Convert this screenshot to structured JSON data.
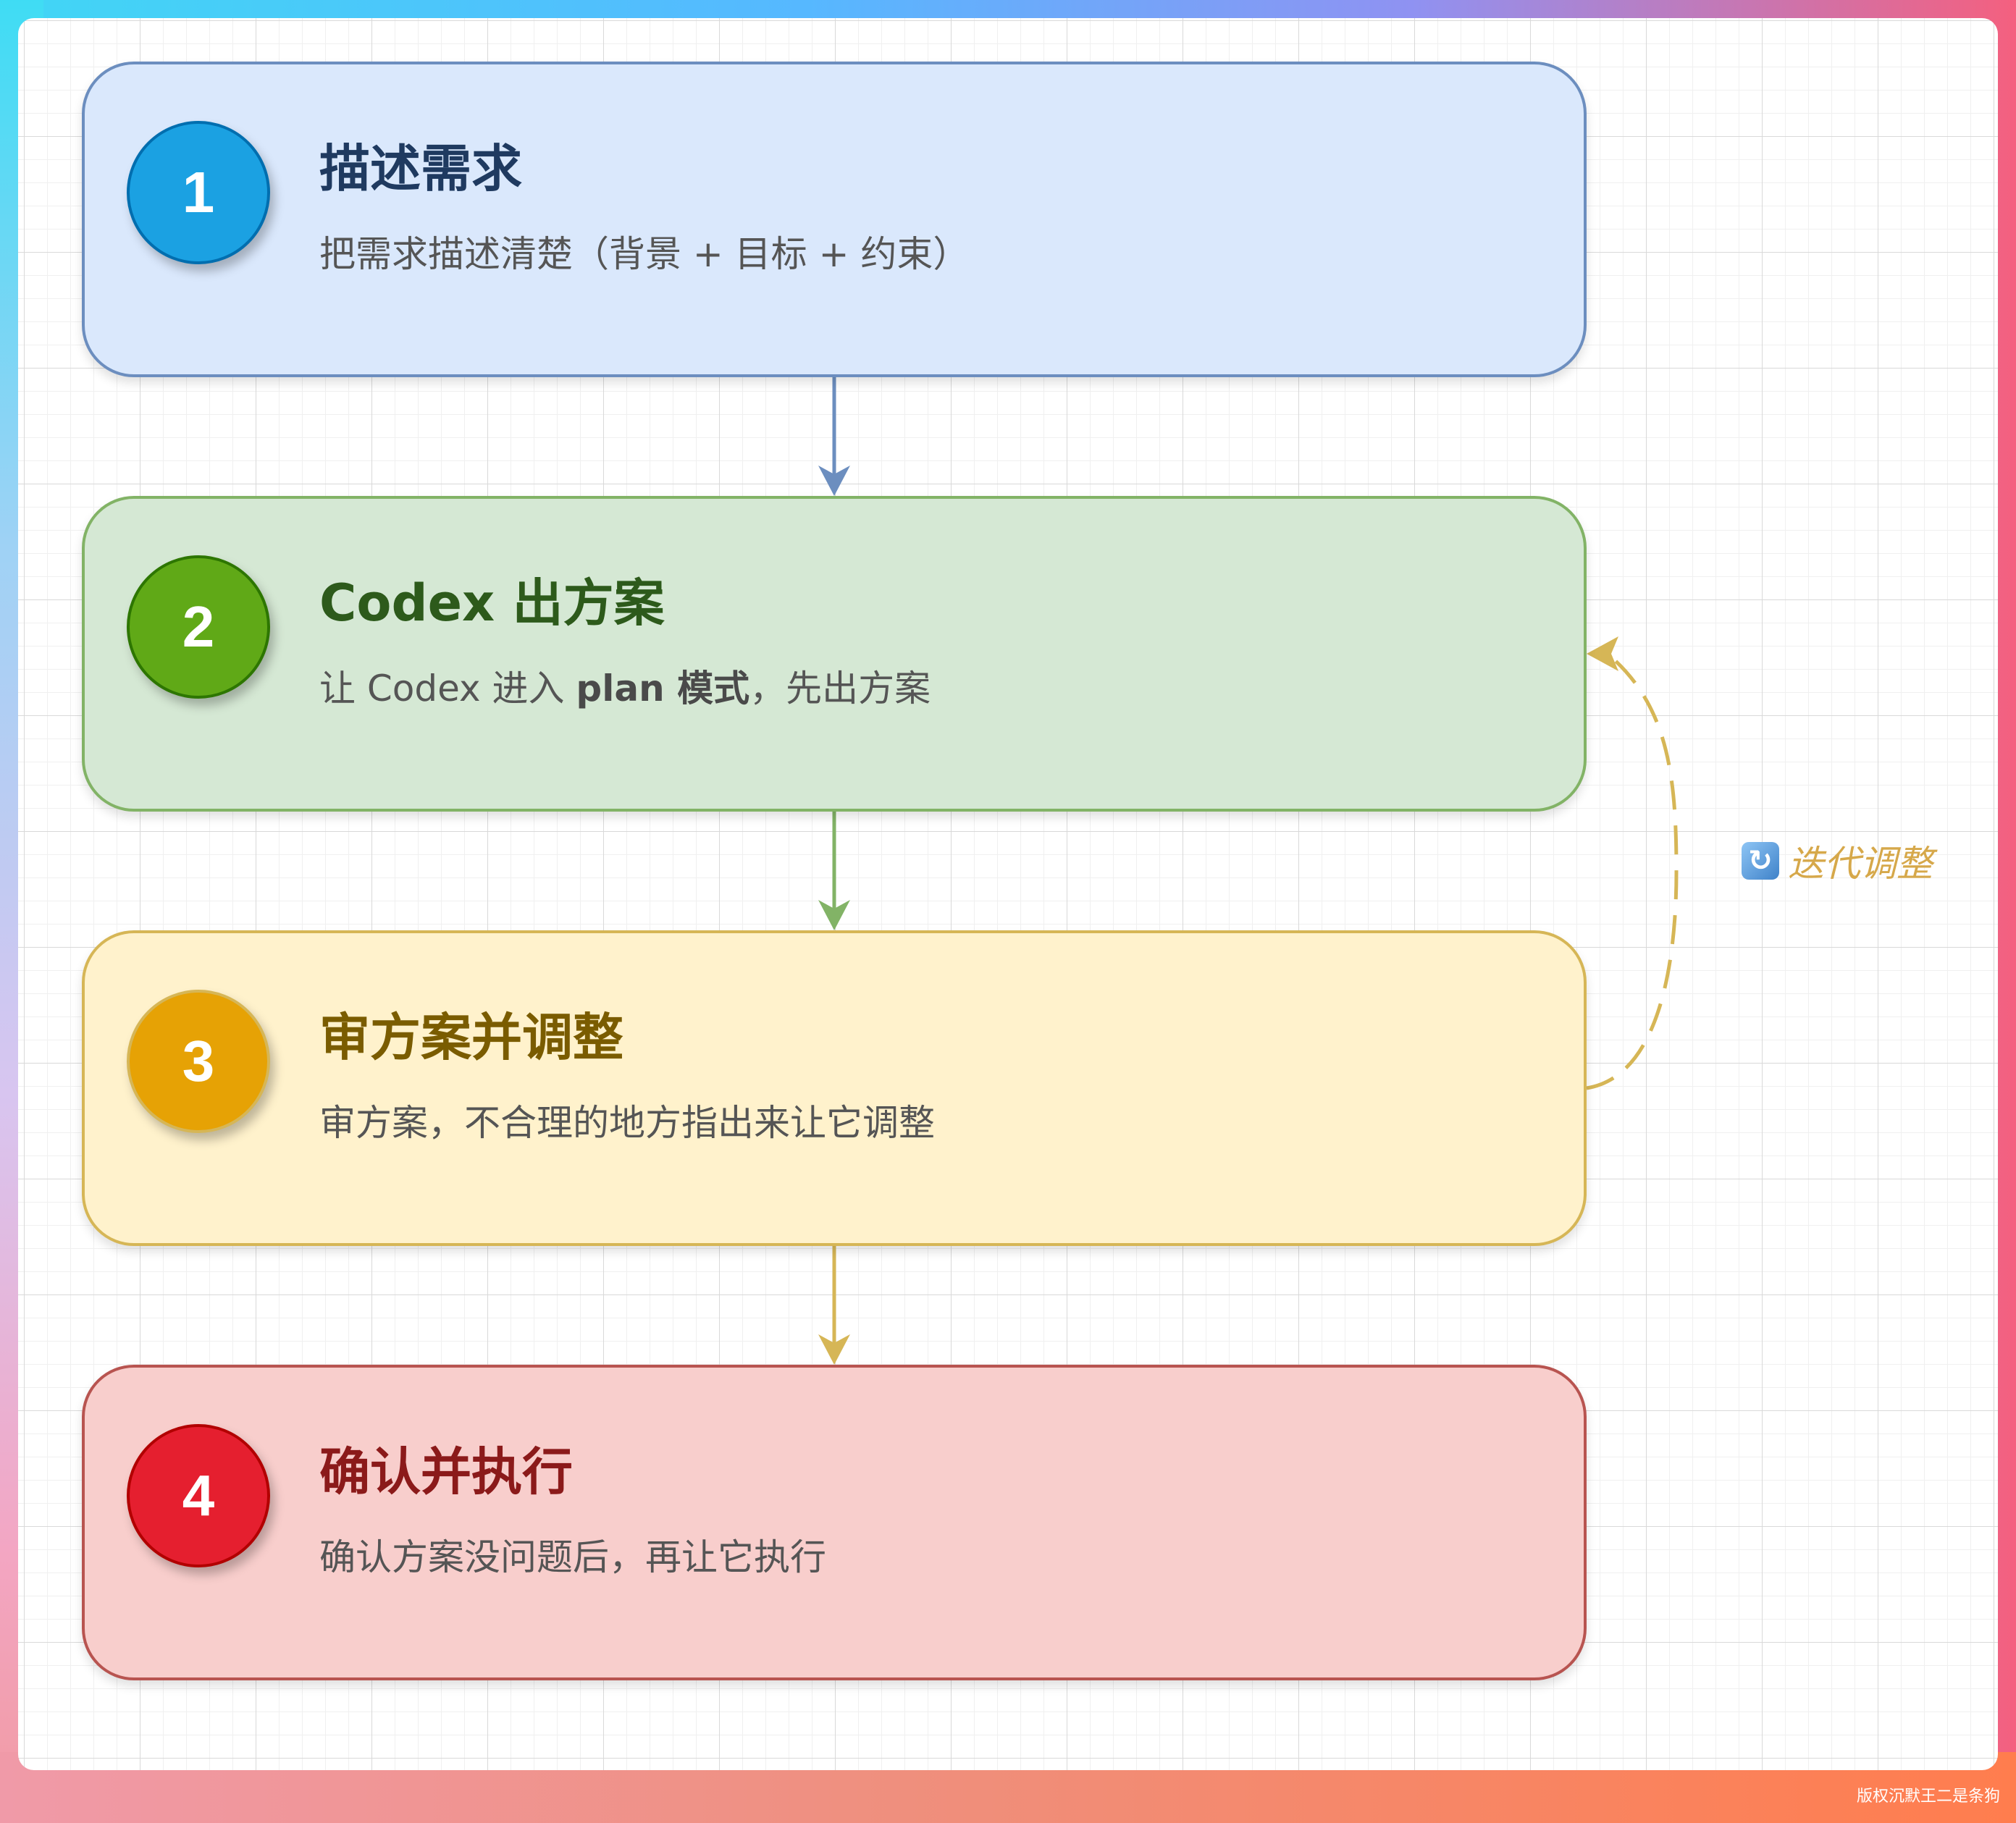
{
  "steps": [
    {
      "number": "1",
      "title": "描述需求",
      "desc": "把需求描述清楚（背景 + 目标 + 约束）",
      "colors": {
        "fill": "#dae8fc",
        "stroke": "#6c8ebf",
        "badge": "#1ba1e2"
      }
    },
    {
      "number": "2",
      "title": "Codex 出方案",
      "desc_prefix": "让 Codex 进入 ",
      "desc_bold": "plan 模式",
      "desc_suffix": "，先出方案",
      "colors": {
        "fill": "#d5e8d4",
        "stroke": "#82b366",
        "badge": "#60a917"
      }
    },
    {
      "number": "3",
      "title": "审方案并调整",
      "desc": "审方案，不合理的地方指出来让它调整",
      "colors": {
        "fill": "#fff2cc",
        "stroke": "#d6b656",
        "badge": "#e6a205"
      }
    },
    {
      "number": "4",
      "title": "确认并执行",
      "desc": "确认方案没问题后，再让它执行",
      "colors": {
        "fill": "#f8cecc",
        "stroke": "#b85450",
        "badge": "#e51f2f"
      }
    }
  ],
  "loop": {
    "icon": "refresh-icon",
    "label": "迭代调整",
    "color": "#d6a84a"
  },
  "watermark": "版权沉默王二是条狗"
}
